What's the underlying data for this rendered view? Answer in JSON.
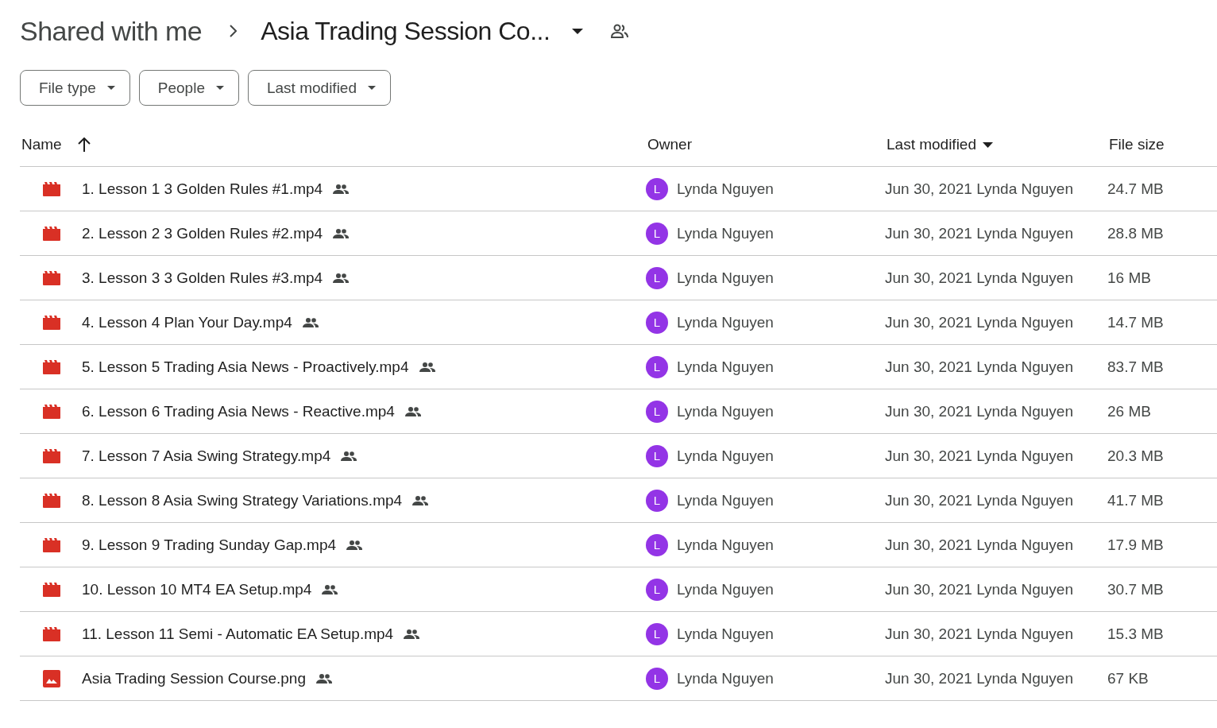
{
  "breadcrumb": {
    "parent": "Shared with me",
    "current": "Asia Trading Session Co..."
  },
  "filters": [
    "File type",
    "People",
    "Last modified"
  ],
  "table": {
    "columns": [
      {
        "label": "Name",
        "kind": "ascending"
      },
      {
        "label": "Owner",
        "kind": "plain"
      },
      {
        "label": "Last modified",
        "kind": "descending"
      },
      {
        "label": "File size",
        "kind": "plain"
      }
    ],
    "rows": [
      {
        "kind": "video",
        "name": "1. Lesson 1 3 Golden Rules #1.mp4",
        "avatar": "L",
        "owner": "Lynda Nguyen",
        "modified": "Jun 30, 2021 Lynda Nguyen",
        "size": "24.7 MB"
      },
      {
        "kind": "video",
        "name": "2. Lesson 2 3 Golden Rules #2.mp4",
        "avatar": "L",
        "owner": "Lynda Nguyen",
        "modified": "Jun 30, 2021 Lynda Nguyen",
        "size": "28.8 MB"
      },
      {
        "kind": "video",
        "name": "3. Lesson 3 3 Golden Rules #3.mp4",
        "avatar": "L",
        "owner": "Lynda Nguyen",
        "modified": "Jun 30, 2021 Lynda Nguyen",
        "size": "16 MB"
      },
      {
        "kind": "video",
        "name": "4. Lesson 4 Plan Your Day.mp4",
        "avatar": "L",
        "owner": "Lynda Nguyen",
        "modified": "Jun 30, 2021 Lynda Nguyen",
        "size": "14.7 MB"
      },
      {
        "kind": "video",
        "name": "5. Lesson 5 Trading Asia News - Proactively.mp4",
        "avatar": "L",
        "owner": "Lynda Nguyen",
        "modified": "Jun 30, 2021 Lynda Nguyen",
        "size": "83.7 MB"
      },
      {
        "kind": "video",
        "name": "6. Lesson 6 Trading Asia News - Reactive.mp4",
        "avatar": "L",
        "owner": "Lynda Nguyen",
        "modified": "Jun 30, 2021 Lynda Nguyen",
        "size": "26 MB"
      },
      {
        "kind": "video",
        "name": "7. Lesson 7 Asia Swing Strategy.mp4",
        "avatar": "L",
        "owner": "Lynda Nguyen",
        "modified": "Jun 30, 2021 Lynda Nguyen",
        "size": "20.3 MB"
      },
      {
        "kind": "video",
        "name": "8. Lesson 8 Asia Swing Strategy Variations.mp4",
        "avatar": "L",
        "owner": "Lynda Nguyen",
        "modified": "Jun 30, 2021 Lynda Nguyen",
        "size": "41.7 MB"
      },
      {
        "kind": "video",
        "name": "9. Lesson 9 Trading Sunday Gap.mp4",
        "avatar": "L",
        "owner": "Lynda Nguyen",
        "modified": "Jun 30, 2021 Lynda Nguyen",
        "size": "17.9 MB"
      },
      {
        "kind": "video",
        "name": "10. Lesson 10 MT4 EA Setup.mp4",
        "avatar": "L",
        "owner": "Lynda Nguyen",
        "modified": "Jun 30, 2021 Lynda Nguyen",
        "size": "30.7 MB"
      },
      {
        "kind": "video",
        "name": "11. Lesson 11 Semi - Automatic EA Setup.mp4",
        "avatar": "L",
        "owner": "Lynda Nguyen",
        "modified": "Jun 30, 2021 Lynda Nguyen",
        "size": "15.3 MB"
      },
      {
        "kind": "image",
        "name": "Asia Trading Session Course.png",
        "avatar": "L",
        "owner": "Lynda Nguyen",
        "modified": "Jun 30, 2021 Lynda Nguyen",
        "size": "67 KB"
      }
    ]
  }
}
